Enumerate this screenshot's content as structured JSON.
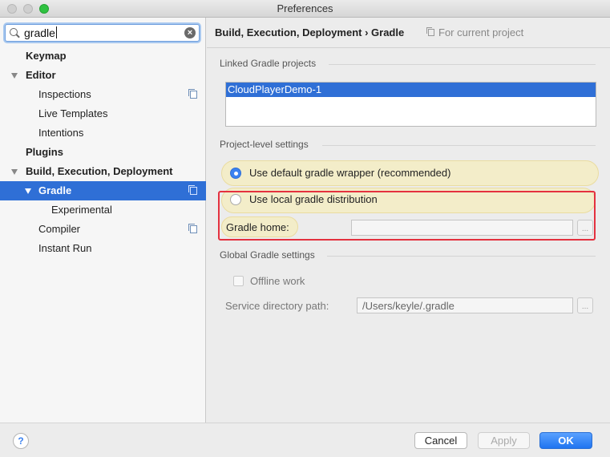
{
  "window": {
    "title": "Preferences"
  },
  "search": {
    "value": "gradle"
  },
  "sidebar": {
    "items": [
      {
        "label": "Keymap"
      },
      {
        "label": "Editor"
      },
      {
        "label": "Inspections"
      },
      {
        "label": "Live Templates"
      },
      {
        "label": "Intentions"
      },
      {
        "label": "Plugins"
      },
      {
        "label": "Build, Execution, Deployment"
      },
      {
        "label": "Gradle"
      },
      {
        "label": "Experimental"
      },
      {
        "label": "Compiler"
      },
      {
        "label": "Instant Run"
      }
    ]
  },
  "header": {
    "breadcrumb": "Build, Execution, Deployment › Gradle",
    "scope": "For current project"
  },
  "linked": {
    "section": "Linked Gradle projects",
    "projects": [
      "CloudPlayerDemo-1"
    ]
  },
  "project_settings": {
    "section": "Project-level settings",
    "option_default": "Use default gradle wrapper (recommended)",
    "option_local": "Use local gradle distribution",
    "selected": "default",
    "gradle_home_label": "Gradle home:",
    "gradle_home_value": ""
  },
  "global_settings": {
    "section": "Global Gradle settings",
    "offline_label": "Offline work",
    "service_label": "Service directory path:",
    "service_value": "/Users/keyle/.gradle"
  },
  "buttons": {
    "help": "?",
    "browse": "...",
    "cancel": "Cancel",
    "apply": "Apply",
    "ok": "OK"
  }
}
